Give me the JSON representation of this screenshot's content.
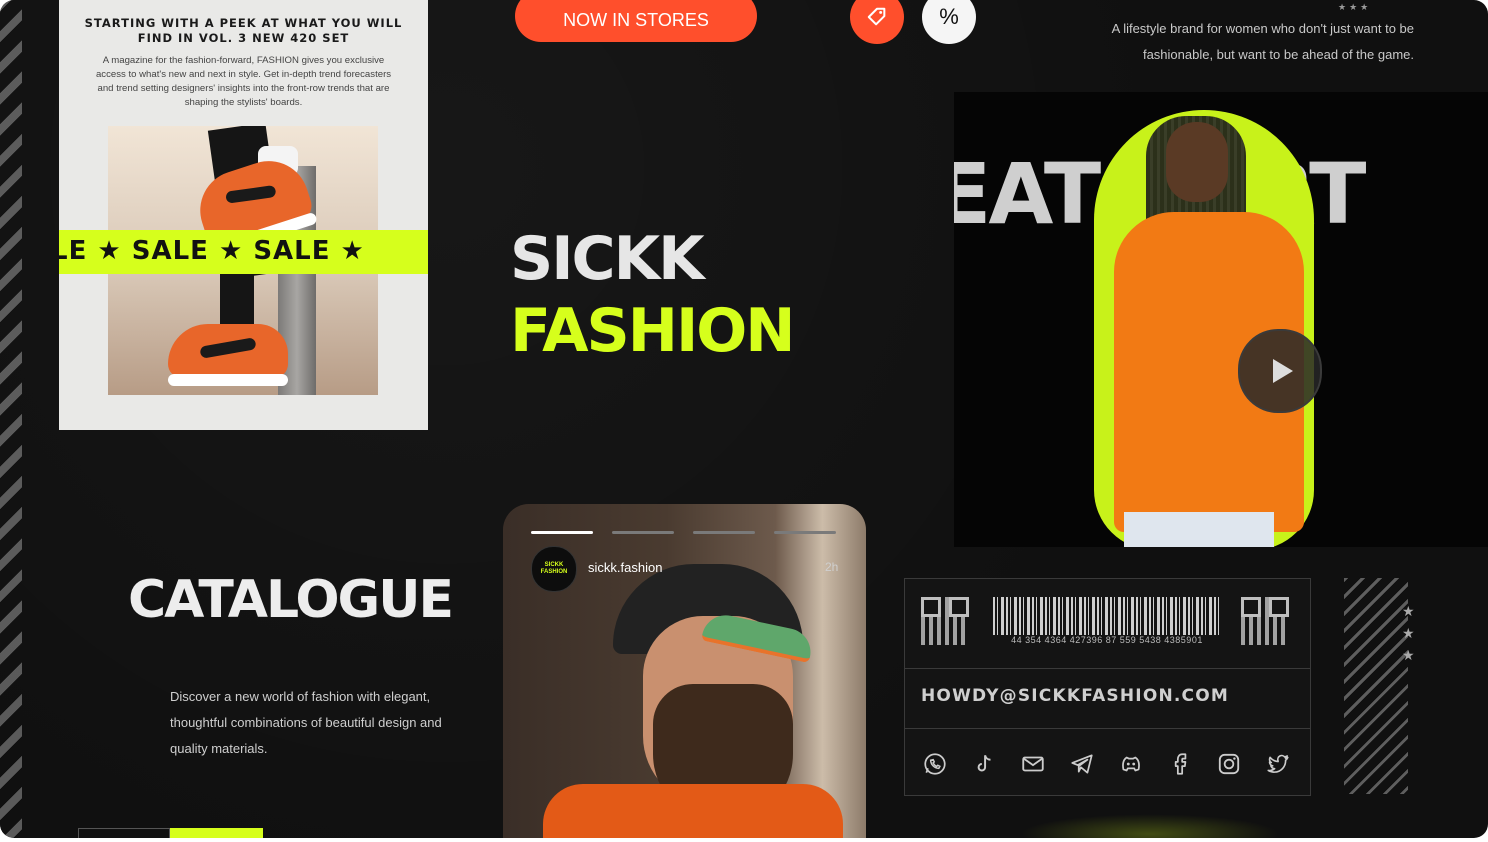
{
  "magazine": {
    "headline": "STARTING WITH A PEEK AT WHAT YOU WILL FIND IN VOL. 3 NEW 420 SET",
    "body": "A magazine for the fashion-forward, FASHION gives you exclusive access to what's new and next in style. Get in-depth trend forecasters and trend setting designers' insights into the front-row trends that are shaping the stylists' boards.",
    "sale_band": "LE ★ SALE ★ SALE ★"
  },
  "top": {
    "pill_label": "NOW IN STORES",
    "tag_icon": "price-tag-icon",
    "percent_icon": "%",
    "tagline": "A lifestyle brand for women who don't just want to be fashionable, but want to be ahead of the game.",
    "stars": "★★★"
  },
  "hero": {
    "line1": "SICKK",
    "line2": "FASHION"
  },
  "promo": {
    "word": "EATSHIRT",
    "play_icon": "play-icon"
  },
  "catalogue": {
    "title": "CATALOGUE",
    "description": "Discover a new world of fashion with elegant, thoughtful combinations of beautiful design and quality materials."
  },
  "story": {
    "avatar_text": "SICKK FASHION",
    "handle": "sickk.fashion",
    "time": "2h"
  },
  "contact": {
    "barcode_number": "44 354 4364 427396 87 559 5438 4385901",
    "email": "HOWDY@SICKKFASHION.COM",
    "social_icons": [
      "whatsapp-icon",
      "tiktok-icon",
      "mail-icon",
      "telegram-icon",
      "discord-icon",
      "facebook-icon",
      "instagram-icon",
      "twitter-icon"
    ]
  },
  "decor": {
    "stars_right": "★\n★\n★"
  },
  "colors": {
    "accent_lime": "#d6ff1c",
    "accent_orange": "#ff4f2c",
    "background": "#101010"
  }
}
